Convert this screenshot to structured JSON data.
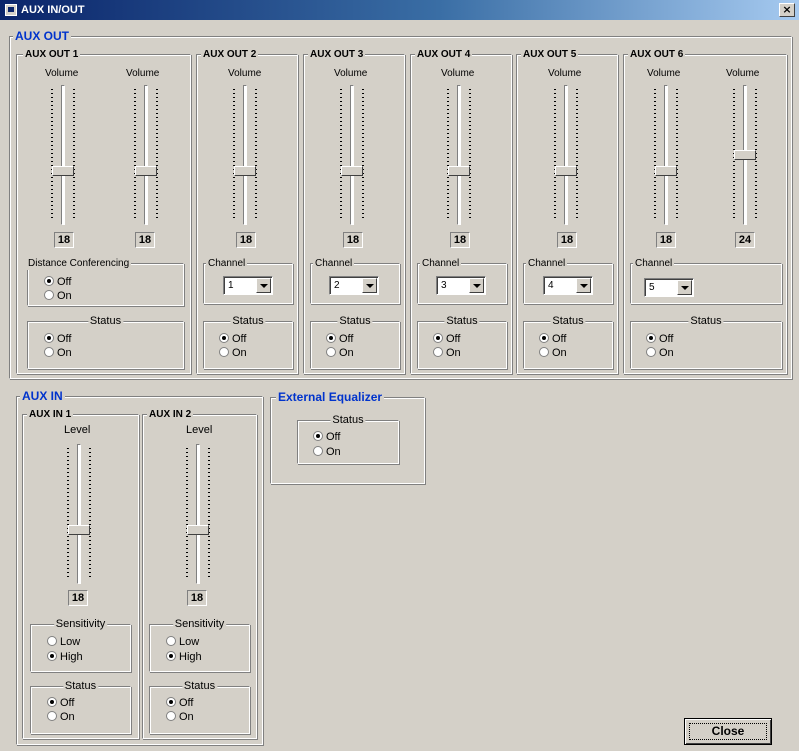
{
  "window": {
    "title": "AUX IN/OUT",
    "close_glyph": "×"
  },
  "aux_out": {
    "title": "AUX OUT",
    "volume_label": "Volume",
    "channel_label": "Channel",
    "status_label": "Status",
    "off_label": "Off",
    "on_label": "On",
    "slider_max": 48,
    "out1": {
      "title": "AUX OUT 1",
      "vol1": "18",
      "vol2": "18",
      "dc_label": "Distance Conferencing",
      "dc": "Off",
      "status": "Off"
    },
    "out2": {
      "title": "AUX OUT 2",
      "vol": "18",
      "channel": "1",
      "status": "Off"
    },
    "out3": {
      "title": "AUX OUT 3",
      "vol": "18",
      "channel": "2",
      "status": "Off"
    },
    "out4": {
      "title": "AUX OUT 4",
      "vol": "18",
      "channel": "3",
      "status": "Off"
    },
    "out5": {
      "title": "AUX OUT 5",
      "vol": "18",
      "channel": "4",
      "status": "Off"
    },
    "out6": {
      "title": "AUX OUT 6",
      "vol1": "18",
      "vol2": "24",
      "channel": "5",
      "status": "Off"
    }
  },
  "aux_in": {
    "title": "AUX IN",
    "level_label": "Level",
    "sensitivity_label": "Sensitivity",
    "low_label": "Low",
    "high_label": "High",
    "status_label": "Status",
    "off_label": "Off",
    "on_label": "On",
    "in1": {
      "title": "AUX IN 1",
      "level": "18",
      "sensitivity": "High",
      "status": "Off"
    },
    "in2": {
      "title": "AUX IN 2",
      "level": "18",
      "sensitivity": "High",
      "status": "Off"
    }
  },
  "ext_eq": {
    "title": "External Equalizer",
    "status_label": "Status",
    "off_label": "Off",
    "on_label": "On",
    "status": "Off"
  },
  "close_label": "Close"
}
